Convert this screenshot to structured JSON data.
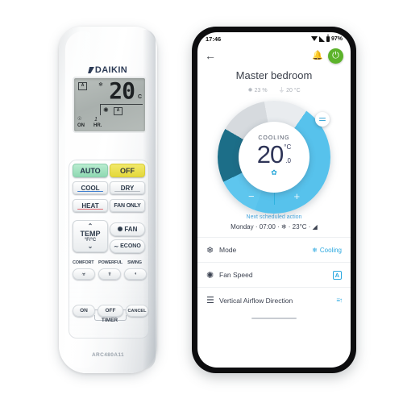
{
  "remote": {
    "brand": "DAIKIN",
    "model": "ARC480A11",
    "lcd": {
      "auto_badge": "A",
      "mode_icon": "snowflake-icon",
      "temperature": "20",
      "unit": "C",
      "fan_icon": "fan-icon",
      "fan_badge": "A",
      "timer_on": "ON",
      "timer_clock_icon": "clock-icon",
      "timer_value": "1",
      "timer_unit": "HR."
    },
    "buttons": [
      {
        "id": "auto",
        "label": "AUTO"
      },
      {
        "id": "off",
        "label": "OFF"
      },
      {
        "id": "cool",
        "label": "COOL"
      },
      {
        "id": "dry",
        "label": "DRY"
      },
      {
        "id": "heat",
        "label": "HEAT"
      },
      {
        "id": "fan_only",
        "label": "FAN ONLY"
      }
    ],
    "temp_button": {
      "label": "TEMP",
      "unit": "°F/°C",
      "up": "⌃",
      "down": "⌄"
    },
    "fan_button": {
      "label": "FAN",
      "icon": "fan-icon"
    },
    "econo_button": {
      "label": "ECONO",
      "icon": "econo-icon"
    },
    "function_buttons": [
      {
        "label": "COMFORT",
        "icon": "comfort-icon"
      },
      {
        "label": "POWERFUL",
        "icon": "powerful-icon"
      },
      {
        "label": "SWING",
        "icon": "swing-icon"
      }
    ],
    "timer_row": {
      "on": "ON",
      "off": "OFF",
      "cancel": "CANCEL",
      "group_label": "TIMER"
    }
  },
  "phone": {
    "status": {
      "time": "17:46",
      "wifi_icon": "wifi-icon",
      "signal_icon": "signal-icon",
      "battery_icon": "battery-icon",
      "battery": "97%"
    },
    "nav": {
      "back_icon": "back-arrow-icon",
      "notification_icon": "bell-icon",
      "power_icon": "power-icon"
    },
    "title": "Master bedroom",
    "room_info": [
      {
        "icon": "humidity-icon",
        "value": "23 %"
      },
      {
        "icon": "thermometer-icon",
        "value": "20 °C"
      }
    ],
    "dial": {
      "mode": "COOLING",
      "temperature": "20",
      "unit": "°C",
      "decimal": ".0",
      "eco_icon": "leaf-icon",
      "handle_icon": "drag-handle-icon",
      "minus": "−",
      "plus": "+"
    },
    "schedule": {
      "title": "Next scheduled action",
      "detail": "Monday · 07:00 · ❄ · 23°C · ◢"
    },
    "settings": [
      {
        "icon": "snowflake-icon",
        "label": "Mode",
        "value": "Cooling",
        "value_icon": "snowflake-icon",
        "value_type": "text"
      },
      {
        "icon": "fan-icon",
        "label": "Fan Speed",
        "value": "A",
        "value_type": "badge"
      },
      {
        "icon": "airflow-icon",
        "label": "Vertical Airflow Direction",
        "value": "≡↑",
        "value_type": "icon"
      }
    ]
  }
}
